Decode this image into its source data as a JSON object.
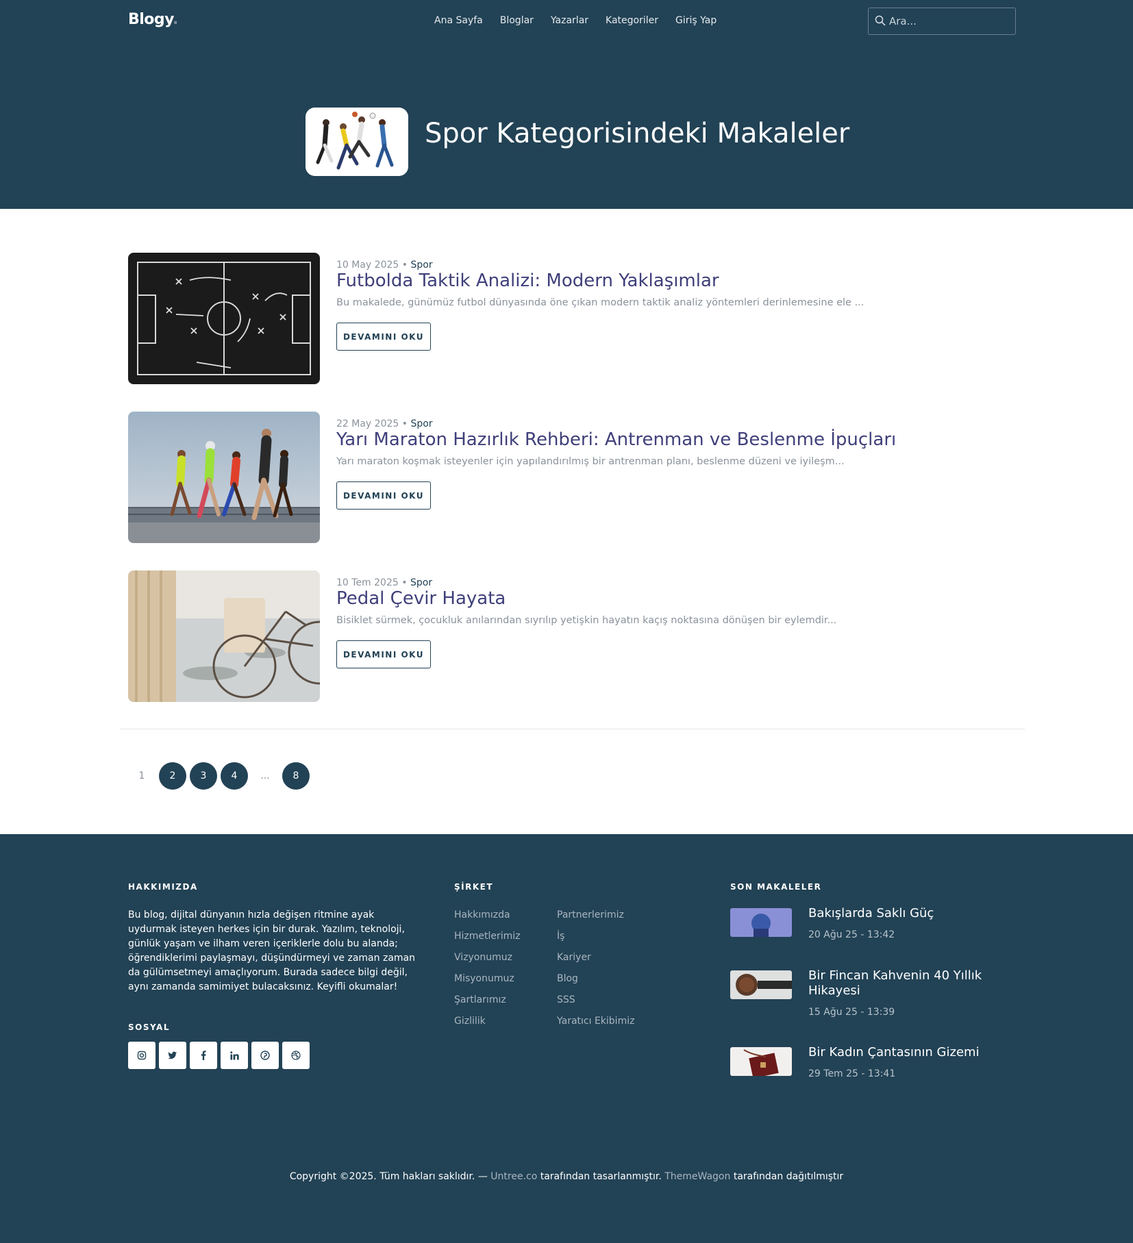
{
  "brand": {
    "name": "Blogy",
    "dot": "."
  },
  "nav": {
    "items": [
      "Ana Sayfa",
      "Bloglar",
      "Yazarlar",
      "Kategoriler",
      "Giriş Yap"
    ]
  },
  "search": {
    "placeholder": "Ara..."
  },
  "hero": {
    "title": "Spor Kategorisindeki Makaleler"
  },
  "articles": [
    {
      "date": "10 May 2025",
      "sep": " • ",
      "category": "Spor",
      "title": "Futbolda Taktik Analizi: Modern Yaklaşımlar",
      "excerpt": "Bu makalede, günümüz futbol dünyasında öne çıkan modern taktik analiz yöntemleri derinlemesine ele ...",
      "button": "DEVAMINI OKU"
    },
    {
      "date": "22 May 2025",
      "sep": " • ",
      "category": "Spor",
      "title": "Yarı Maraton Hazırlık Rehberi: Antrenman ve Beslenme İpuçları",
      "excerpt": "Yarı maraton koşmak isteyenler için yapılandırılmış bir antrenman planı, beslenme düzeni ve iyileşm...",
      "button": "DEVAMINI OKU"
    },
    {
      "date": "10 Tem 2025",
      "sep": " • ",
      "category": "Spor",
      "title": "Pedal Çevir Hayata",
      "excerpt": "Bisiklet sürmek, çocukluk anılarından sıyrılıp yetişkin hayatın kaçış noktasına dönüşen bir eylemdir...",
      "button": "DEVAMINI OKU"
    }
  ],
  "pagination": {
    "current": "1",
    "pages": [
      "2",
      "3",
      "4"
    ],
    "ellipsis": "...",
    "last": "8"
  },
  "footer": {
    "about": {
      "heading": "HAKKIMIZDA",
      "text": "Bu blog, dijital dünyanın hızla değişen ritmine ayak uydurmak isteyen herkes için bir durak. Yazılım, teknoloji, günlük yaşam ve ilham veren içeriklerle dolu bu alanda; öğrendiklerimi paylaşmayı, düşündürmeyi ve zaman zaman da gülümsetmeyi amaçlıyorum. Burada sadece bilgi değil, aynı zamanda samimiyet bulacaksınız. Keyifli okumalar!"
    },
    "social": {
      "heading": "SOSYAL",
      "icons": [
        "instagram-icon",
        "twitter-icon",
        "facebook-icon",
        "linkedin-icon",
        "pinterest-icon",
        "dribbble-icon"
      ]
    },
    "company": {
      "heading": "ŞİRKET",
      "col1": [
        "Hakkımızda",
        "Hizmetlerimiz",
        "Vizyonumuz",
        "Misyonumuz",
        "Şartlarımız",
        "Gizlilik"
      ],
      "col2": [
        "Partnerlerimiz",
        "İş",
        "Kariyer",
        "Blog",
        "SSS",
        "Yaratıcı Ekibimiz"
      ]
    },
    "recent": {
      "heading": "SON MAKALELER",
      "items": [
        {
          "title": "Bakışlarda Saklı Güç",
          "date": "20 Ağu 25 - 13:42"
        },
        {
          "title": "Bir Fincan Kahvenin 40 Yıllık Hikayesi",
          "date": "15 Ağu 25 - 13:39"
        },
        {
          "title": "Bir Kadın Çantasının Gizemi",
          "date": "29 Tem 25 - 13:41"
        }
      ]
    },
    "copyright": {
      "prefix": "Copyright ©2025. Tüm hakları saklıdır. — ",
      "link1": "Untree.co",
      "mid": " tarafından tasarlanmıştır. ",
      "link2": "ThemeWagon",
      "suffix": " tarafından dağıtılmıştır"
    }
  },
  "colors": {
    "navy": "#224255",
    "title": "#3f3f7a",
    "muted": "#8a929b"
  }
}
